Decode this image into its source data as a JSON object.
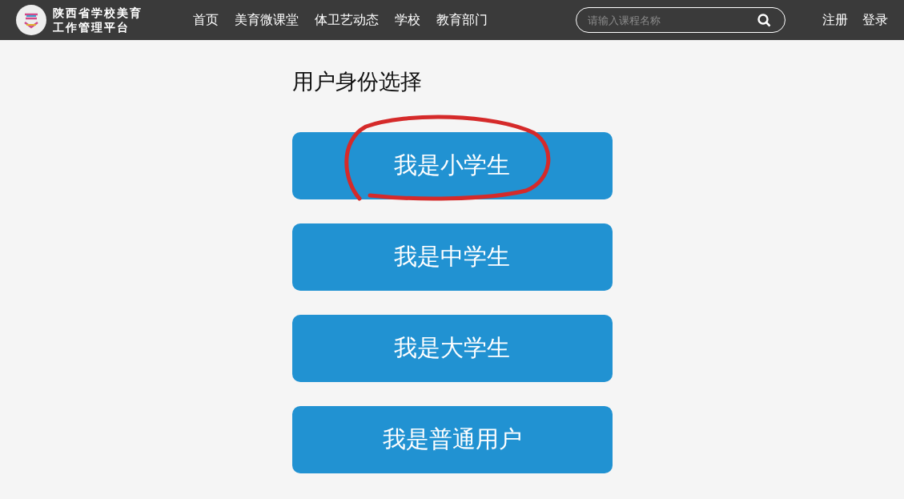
{
  "header": {
    "logo_text": [
      "陕西省学校美育",
      "工作管理平台"
    ],
    "nav": [
      {
        "label": "首页"
      },
      {
        "label": "美育微课堂"
      },
      {
        "label": "体卫艺动态"
      },
      {
        "label": "学校"
      },
      {
        "label": "教育部门"
      }
    ],
    "search": {
      "placeholder": "请输入课程名称"
    },
    "auth": [
      {
        "label": "注册"
      },
      {
        "label": "登录"
      }
    ]
  },
  "page_title": "用户身份选择",
  "options": [
    {
      "label": "我是小学生",
      "circled": true
    },
    {
      "label": "我是中学生",
      "circled": false
    },
    {
      "label": "我是大学生",
      "circled": false
    },
    {
      "label": "我是普通用户",
      "circled": false
    }
  ]
}
